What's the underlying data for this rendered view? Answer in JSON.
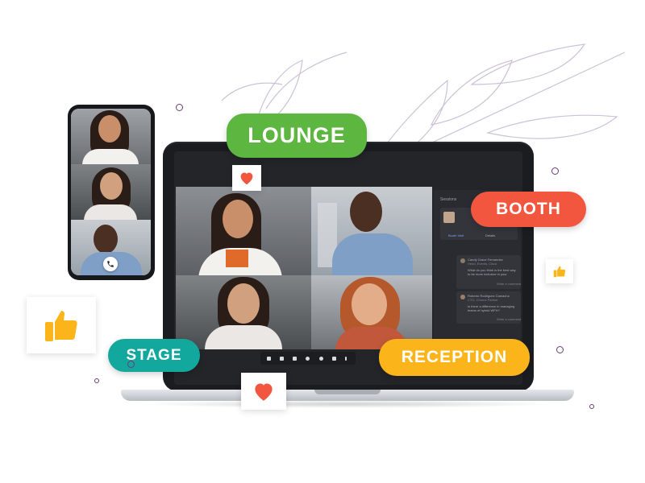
{
  "labels": {
    "lounge": "LOUNGE",
    "booth": "BOOTH",
    "stage": "STAGE",
    "reception": "RECEPTION"
  },
  "colors": {
    "lounge": "#5cb63f",
    "booth": "#f2563f",
    "stage": "#13a89e",
    "reception": "#fbb51b",
    "heart": "#f2563f",
    "thumb": "#fbb51b"
  },
  "panel": {
    "title": "Sessions",
    "booth_row": {
      "left": "Booth Visit",
      "right": "Details"
    },
    "messages": [
      {
        "name": "Candy Grace Fernandez",
        "meta": "Head, Events, Cisco",
        "text": "What do you think is the best way to be more inclusive in your company?",
        "action": "Write a comment"
      },
      {
        "name": "Roberto Rodriguez Camacho",
        "meta": "CTO, Chorus Partner",
        "text": "Is there a difference in managing teams of hybrid WFH?",
        "action": "Write a comment"
      }
    ]
  },
  "icons": {
    "heart_top": "heart-icon",
    "heart_bottom": "heart-icon",
    "thumb_left": "thumbs-up-icon",
    "thumb_right": "thumbs-up-icon",
    "call": "phone-icon"
  }
}
